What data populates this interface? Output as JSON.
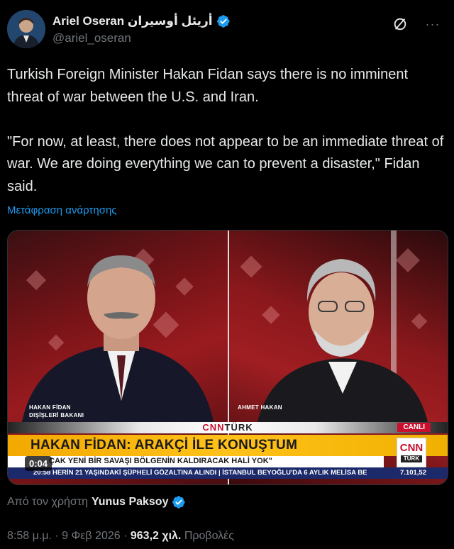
{
  "author": {
    "display_name": "Ariel Oseran أريئل أوسيران",
    "handle": "@ariel_oseran",
    "verified": true,
    "avatar_icon": "person-avatar"
  },
  "actions": {
    "grok_icon": "grok-icon",
    "more_icon": "more-icon",
    "more_label": "···"
  },
  "tweet": {
    "text": "Turkish Foreign Minister Hakan Fidan says there is no imminent threat of war between the U.S. and Iran.\n\n\"For now, at least, there does not appear to be an immediate threat of war. We are doing everything we can to prevent a disaster,\" Fidan said.",
    "translate_label": "Μετάφραση ανάρτησης"
  },
  "video": {
    "duration": "0:04",
    "left_name": "HAKAN FİDAN",
    "left_title": "DIŞİŞLERİ BAKANI",
    "right_name": "AHMET HAKAN",
    "brand_cnn": "CNN",
    "brand_turk": "TÜRK",
    "live_badge": "CANLI",
    "headline": "HAKAN FİDAN: ARAKÇİ İLE KONUŞTUM",
    "subheadline": "ÇAK YENİ BİR SAVAŞI BÖLGENİN KALDIRACAK HALİ YOK\"",
    "ticker_time": "20:58",
    "ticker_text": "HERİN 21 YAŞINDAKİ ŞÜPHELİ GÖZALTINA ALINDI  |  İSTANBUL BEYOĞLU'DA 6 AYLIK MELİSA BE",
    "ticker_value": "7.101,52",
    "logo_cnn": "CNN",
    "logo_turk": "TÜRK"
  },
  "attribution": {
    "prefix": "Από τον χρήστη",
    "author": "Yunus Paksoy",
    "verified": true
  },
  "meta": {
    "time": "8:58 μ.μ.",
    "separator": "·",
    "date": "9 Φεβ 2026",
    "views_count": "963,2 χιλ.",
    "views_label": "Προβολές"
  },
  "colors": {
    "background": "#000000",
    "text": "#e7e9ea",
    "secondary": "#71767b",
    "link": "#1d9bf0",
    "verified": "#1d9bf0"
  }
}
